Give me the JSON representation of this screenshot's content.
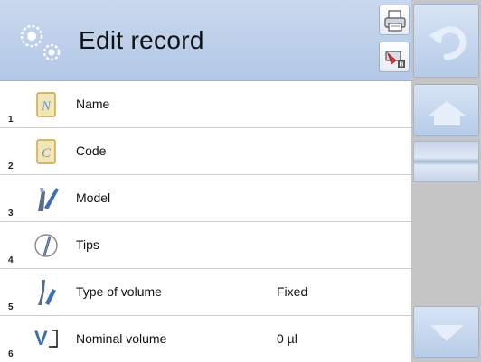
{
  "header": {
    "title": "Edit record",
    "icons": {
      "app": "gears-icon",
      "print": "printer-icon",
      "export": "export-icon"
    }
  },
  "rows": [
    {
      "num": "1",
      "icon": "name-icon",
      "label": "Name",
      "value": ""
    },
    {
      "num": "2",
      "icon": "code-icon",
      "label": "Code",
      "value": ""
    },
    {
      "num": "3",
      "icon": "model-icon",
      "label": "Model",
      "value": ""
    },
    {
      "num": "4",
      "icon": "tips-icon",
      "label": "Tips",
      "value": ""
    },
    {
      "num": "5",
      "icon": "volume-type-icon",
      "label": "Type of volume",
      "value": "Fixed"
    },
    {
      "num": "6",
      "icon": "nominal-volume-icon",
      "label": "Nominal volume",
      "value": "0 µl"
    }
  ],
  "sidebar": {
    "icons": {
      "back": "undo-arrow-icon",
      "home": "home-icon",
      "down": "arrow-down-icon"
    }
  },
  "colors": {
    "header_bg": "#b9cce8",
    "side_bg": "#c5c5c5",
    "accent": "#6f95c9"
  }
}
